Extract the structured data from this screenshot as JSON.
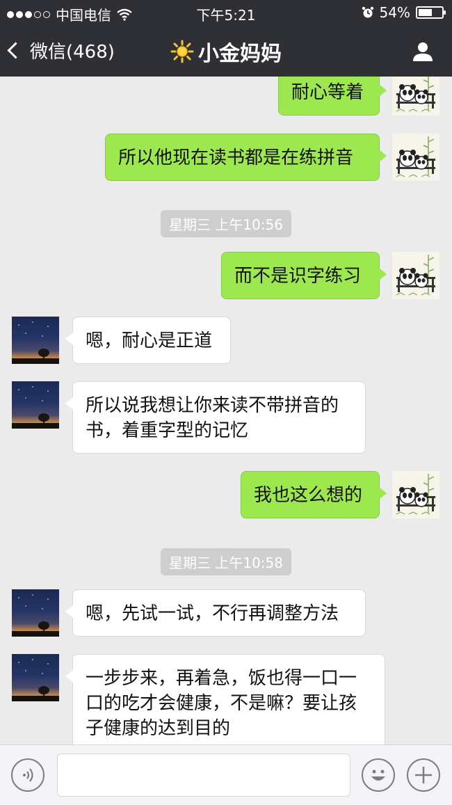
{
  "status_bar": {
    "carrier": "中国电信",
    "time": "下午5:21",
    "battery": "54%",
    "battery_level": 0.54,
    "signal_bars": 3,
    "signal_total": 5
  },
  "nav": {
    "back_label": "微信(468)",
    "title": "小金妈妈",
    "title_icon": "sun-emoji",
    "profile_icon": "person-icon"
  },
  "messages": [
    {
      "type": "me",
      "text": "耐心等着"
    },
    {
      "type": "me",
      "text": "所以他现在读书都是在练拼音"
    },
    {
      "type": "time",
      "text": "星期三 上午10:56"
    },
    {
      "type": "me",
      "text": "而不是识字练习"
    },
    {
      "type": "them",
      "text": "嗯，耐心是正道"
    },
    {
      "type": "them",
      "text": "所以说我想让你来读不带拼音的书，着重字型的记忆"
    },
    {
      "type": "me",
      "text": "我也这么想的"
    },
    {
      "type": "time",
      "text": "星期三 上午10:58"
    },
    {
      "type": "them",
      "text": "嗯，先试一试，不行再调整方法"
    },
    {
      "type": "them",
      "text": "一步步来，再着急，饭也得一口一口的吃才会健康，不是嘛？要让孩子健康的达到目的"
    }
  ],
  "input_bar": {
    "voice_icon": "voice-icon",
    "emoji_icon": "emoji-icon",
    "plus_icon": "plus-icon",
    "text_value": ""
  }
}
